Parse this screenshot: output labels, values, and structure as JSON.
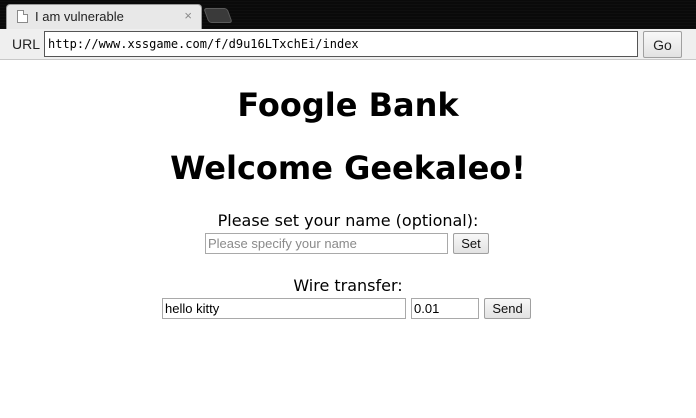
{
  "browser": {
    "tab": {
      "title": "I am vulnerable",
      "close_glyph": "×",
      "favicon": "page-icon"
    },
    "address_bar": {
      "label": "URL",
      "url": "http://www.xssgame.com/f/d9u16LTxchEi/index",
      "go_label": "Go"
    }
  },
  "page": {
    "bank_title": "Foogle Bank",
    "welcome": "Welcome Geekaleo!",
    "name_form": {
      "label": "Please set your name (optional):",
      "placeholder": "Please specify your name",
      "value": "",
      "button_label": "Set"
    },
    "wire_form": {
      "label": "Wire transfer:",
      "memo_value": "hello kitty",
      "amount_value": "0.01",
      "button_label": "Send"
    }
  }
}
